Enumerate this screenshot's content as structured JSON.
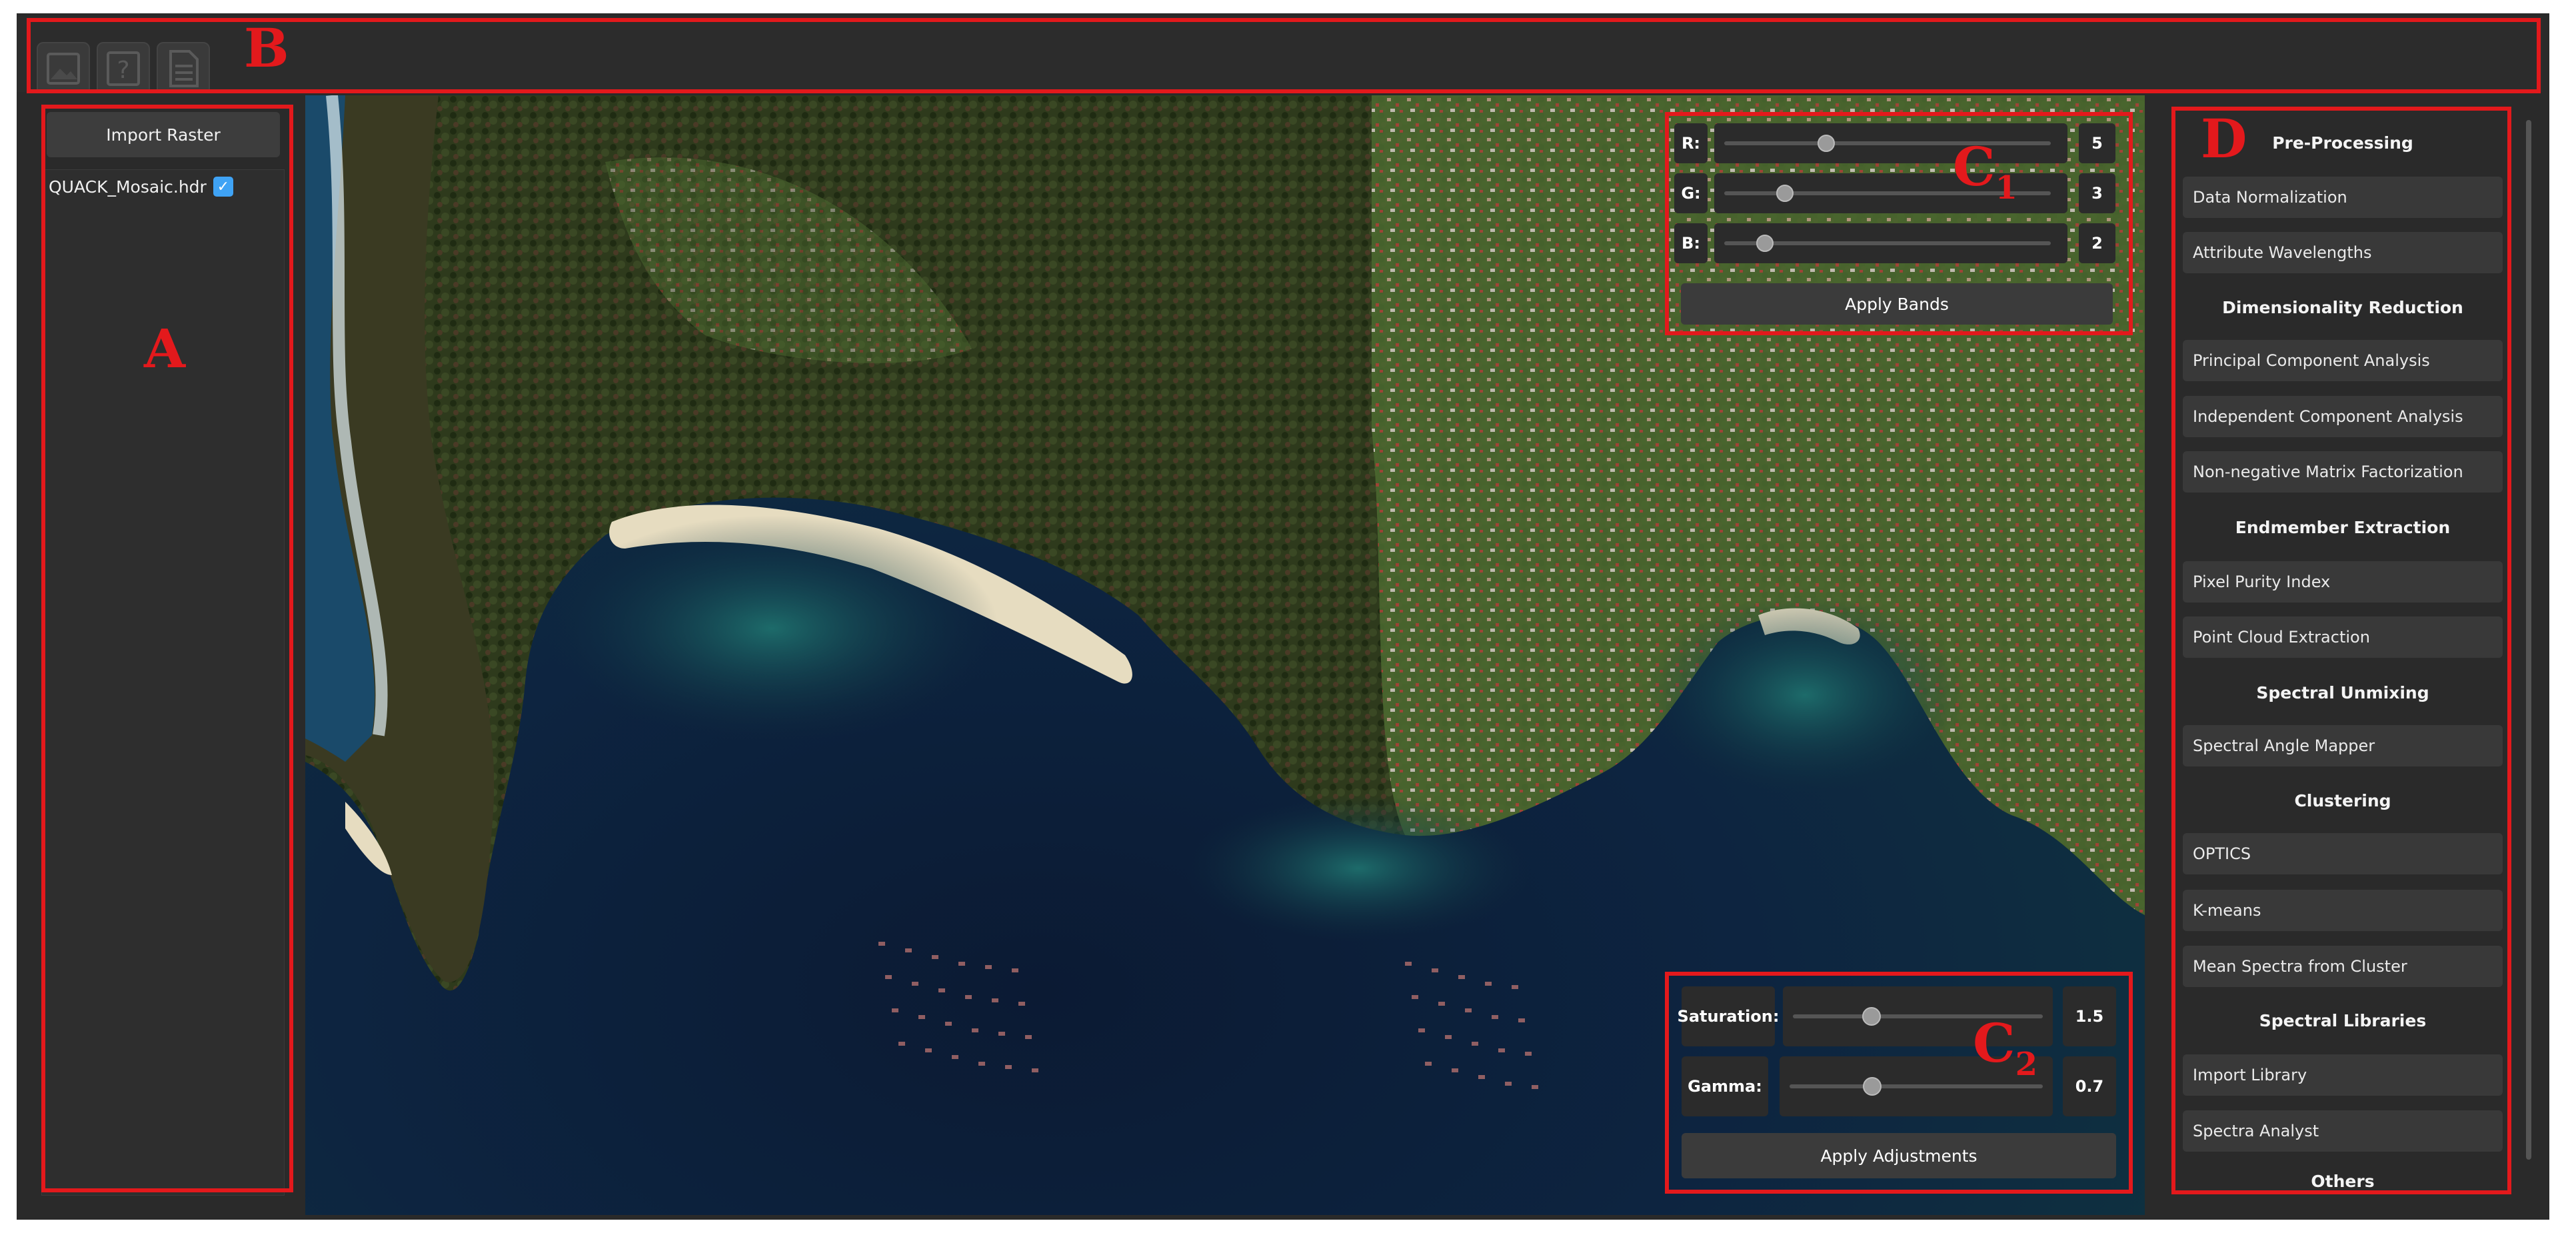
{
  "toolbar": {
    "buttons": [
      {
        "icon": "image-icon"
      },
      {
        "icon": "help-icon"
      },
      {
        "icon": "document-icon"
      }
    ]
  },
  "left_panel": {
    "import_button": "Import Raster",
    "layers": [
      {
        "name": "QUACK_Mosaic.hdr",
        "checked": true
      }
    ]
  },
  "band_panel": {
    "bands": [
      {
        "label": "R:",
        "value": "5"
      },
      {
        "label": "G:",
        "value": "3"
      },
      {
        "label": "B:",
        "value": "2"
      }
    ],
    "apply_label": "Apply Bands"
  },
  "adjust_panel": {
    "saturation_label": "Saturation:",
    "saturation_value": "1.5",
    "gamma_label": "Gamma:",
    "gamma_value": "0.7",
    "apply_label": "Apply Adjustments"
  },
  "right_panel": {
    "sections": [
      {
        "heading": "Pre-Processing",
        "items": [
          "Data Normalization",
          "Attribute Wavelengths"
        ]
      },
      {
        "heading": "Dimensionality Reduction",
        "items": [
          "Principal Component Analysis",
          "Independent Component Analysis",
          "Non-negative Matrix Factorization"
        ]
      },
      {
        "heading": "Endmember Extraction",
        "items": [
          "Pixel Purity Index",
          "Point Cloud Extraction"
        ]
      },
      {
        "heading": "Spectral Unmixing",
        "items": [
          "Spectral Angle Mapper"
        ]
      },
      {
        "heading": "Clustering",
        "items": [
          "OPTICS",
          "K-means",
          "Mean Spectra from Cluster"
        ]
      },
      {
        "heading": "Spectral Libraries",
        "items": [
          "Import Library",
          "Spectra Analyst"
        ]
      },
      {
        "heading": "Others",
        "items": []
      }
    ]
  },
  "annotations": {
    "a": "A",
    "b": "B",
    "c1": "C",
    "c1_sub": "1",
    "c2": "C",
    "c2_sub": "2",
    "d": "D"
  },
  "colors": {
    "annotation_red": "#e3191c",
    "panel_bg": "#2a2a2a",
    "button_bg": "#393939",
    "checkbox_blue": "#3fa3f5"
  }
}
